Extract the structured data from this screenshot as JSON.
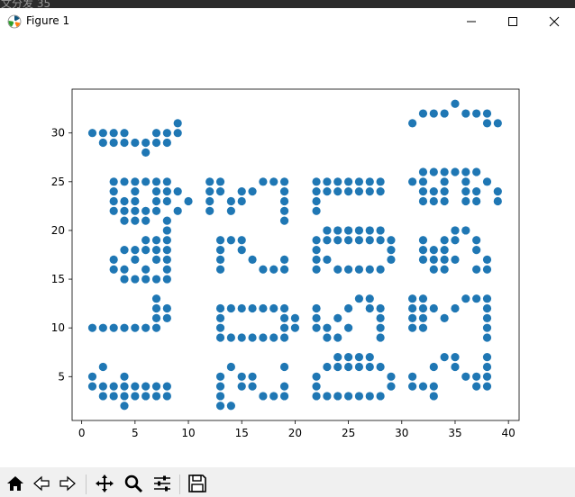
{
  "taskbar": {
    "text": "文分发 35"
  },
  "window": {
    "title": "Figure 1"
  },
  "toolbar": {
    "buttons": [
      "home-icon",
      "back-icon",
      "forward-icon",
      "pan-icon",
      "zoom-icon",
      "configure-subplots-icon",
      "save-icon"
    ]
  },
  "chart_data": {
    "type": "scatter",
    "title": "",
    "xlabel": "",
    "ylabel": "",
    "xlim": [
      -0.9,
      41.0
    ],
    "ylim": [
      0.5,
      34.5
    ],
    "xticks": [
      0,
      5,
      10,
      15,
      20,
      25,
      30,
      35,
      40
    ],
    "yticks": [
      5,
      10,
      15,
      20,
      25,
      30
    ],
    "xtick_labels": [
      "0",
      "5",
      "10",
      "15",
      "20",
      "25",
      "30",
      "35",
      "40"
    ],
    "ytick_labels": [
      "5",
      "10",
      "15",
      "20",
      "25",
      "30"
    ],
    "grid": false,
    "marker_color": "#1f77b4",
    "points": [
      [
        1,
        30
      ],
      [
        2,
        30
      ],
      [
        3,
        30
      ],
      [
        4,
        30
      ],
      [
        2,
        29
      ],
      [
        3,
        29
      ],
      [
        4,
        29
      ],
      [
        5,
        29
      ],
      [
        6,
        29
      ],
      [
        7,
        29
      ],
      [
        8,
        29
      ],
      [
        6,
        28
      ],
      [
        7,
        30
      ],
      [
        8,
        30
      ],
      [
        9,
        30
      ],
      [
        9,
        31
      ],
      [
        3,
        25
      ],
      [
        4,
        25
      ],
      [
        5,
        25
      ],
      [
        6,
        25
      ],
      [
        7,
        25
      ],
      [
        8,
        25
      ],
      [
        3,
        24
      ],
      [
        5,
        24
      ],
      [
        7,
        24
      ],
      [
        8,
        24
      ],
      [
        9,
        24
      ],
      [
        3,
        23
      ],
      [
        4,
        23
      ],
      [
        5,
        23
      ],
      [
        7,
        23
      ],
      [
        8,
        23
      ],
      [
        10,
        23
      ],
      [
        3,
        22
      ],
      [
        4,
        22
      ],
      [
        5,
        22
      ],
      [
        6,
        22
      ],
      [
        7,
        22
      ],
      [
        9,
        22
      ],
      [
        4,
        21
      ],
      [
        5,
        21
      ],
      [
        6,
        21
      ],
      [
        8,
        21
      ],
      [
        8,
        20
      ],
      [
        6,
        19
      ],
      [
        7,
        19
      ],
      [
        8,
        19
      ],
      [
        4,
        18
      ],
      [
        5,
        18
      ],
      [
        6,
        18
      ],
      [
        7,
        18
      ],
      [
        8,
        18
      ],
      [
        3,
        17
      ],
      [
        5,
        17
      ],
      [
        7,
        17
      ],
      [
        8,
        17
      ],
      [
        3,
        16
      ],
      [
        4,
        16
      ],
      [
        6,
        16
      ],
      [
        8,
        16
      ],
      [
        4,
        15
      ],
      [
        5,
        15
      ],
      [
        6,
        15
      ],
      [
        7,
        15
      ],
      [
        8,
        15
      ],
      [
        7,
        13
      ],
      [
        7,
        12
      ],
      [
        8,
        12
      ],
      [
        7,
        11
      ],
      [
        8,
        11
      ],
      [
        1,
        10
      ],
      [
        2,
        10
      ],
      [
        3,
        10
      ],
      [
        4,
        10
      ],
      [
        5,
        10
      ],
      [
        6,
        10
      ],
      [
        7,
        10
      ],
      [
        1,
        5
      ],
      [
        4,
        5
      ],
      [
        2,
        6
      ],
      [
        1,
        4
      ],
      [
        2,
        4
      ],
      [
        3,
        4
      ],
      [
        4,
        4
      ],
      [
        5,
        4
      ],
      [
        6,
        4
      ],
      [
        7,
        4
      ],
      [
        8,
        4
      ],
      [
        2,
        3
      ],
      [
        3,
        3
      ],
      [
        4,
        3
      ],
      [
        5,
        3
      ],
      [
        6,
        3
      ],
      [
        7,
        3
      ],
      [
        8,
        3
      ],
      [
        4,
        2
      ],
      [
        12,
        25
      ],
      [
        13,
        25
      ],
      [
        17,
        25
      ],
      [
        18,
        25
      ],
      [
        19,
        25
      ],
      [
        12,
        24
      ],
      [
        13,
        24
      ],
      [
        15,
        24
      ],
      [
        16,
        24
      ],
      [
        19,
        24
      ],
      [
        12,
        23
      ],
      [
        14,
        23
      ],
      [
        15,
        23
      ],
      [
        19,
        23
      ],
      [
        12,
        22
      ],
      [
        14,
        22
      ],
      [
        19,
        22
      ],
      [
        19,
        21
      ],
      [
        13,
        19
      ],
      [
        14,
        19
      ],
      [
        15,
        19
      ],
      [
        13,
        18
      ],
      [
        15,
        18
      ],
      [
        13,
        17
      ],
      [
        16,
        17
      ],
      [
        19,
        17
      ],
      [
        13,
        16
      ],
      [
        17,
        16
      ],
      [
        18,
        16
      ],
      [
        19,
        16
      ],
      [
        13,
        12
      ],
      [
        14,
        12
      ],
      [
        15,
        12
      ],
      [
        16,
        12
      ],
      [
        17,
        12
      ],
      [
        18,
        12
      ],
      [
        19,
        12
      ],
      [
        13,
        11
      ],
      [
        19,
        11
      ],
      [
        20,
        11
      ],
      [
        13,
        10
      ],
      [
        19,
        10
      ],
      [
        20,
        10
      ],
      [
        13,
        9
      ],
      [
        14,
        9
      ],
      [
        15,
        9
      ],
      [
        16,
        9
      ],
      [
        17,
        9
      ],
      [
        18,
        9
      ],
      [
        19,
        9
      ],
      [
        13,
        5
      ],
      [
        14,
        6
      ],
      [
        15,
        5
      ],
      [
        16,
        5
      ],
      [
        19,
        6
      ],
      [
        13,
        4
      ],
      [
        15,
        4
      ],
      [
        16,
        4
      ],
      [
        19,
        4
      ],
      [
        13,
        3
      ],
      [
        17,
        3
      ],
      [
        18,
        3
      ],
      [
        19,
        3
      ],
      [
        13,
        2
      ],
      [
        14,
        2
      ],
      [
        22,
        25
      ],
      [
        23,
        25
      ],
      [
        24,
        25
      ],
      [
        25,
        25
      ],
      [
        26,
        25
      ],
      [
        27,
        25
      ],
      [
        28,
        25
      ],
      [
        22,
        24
      ],
      [
        23,
        24
      ],
      [
        24,
        24
      ],
      [
        25,
        24
      ],
      [
        26,
        24
      ],
      [
        27,
        24
      ],
      [
        28,
        24
      ],
      [
        22,
        23
      ],
      [
        22,
        22
      ],
      [
        23,
        20
      ],
      [
        24,
        20
      ],
      [
        25,
        20
      ],
      [
        26,
        20
      ],
      [
        27,
        20
      ],
      [
        28,
        20
      ],
      [
        22,
        19
      ],
      [
        23,
        19
      ],
      [
        24,
        19
      ],
      [
        25,
        19
      ],
      [
        26,
        19
      ],
      [
        27,
        19
      ],
      [
        28,
        19
      ],
      [
        29,
        19
      ],
      [
        22,
        18
      ],
      [
        29,
        18
      ],
      [
        22,
        17
      ],
      [
        23,
        17
      ],
      [
        29,
        17
      ],
      [
        22,
        16
      ],
      [
        24,
        16
      ],
      [
        25,
        16
      ],
      [
        26,
        16
      ],
      [
        27,
        16
      ],
      [
        28,
        16
      ],
      [
        26,
        13
      ],
      [
        27,
        13
      ],
      [
        25,
        12
      ],
      [
        27,
        12
      ],
      [
        28,
        12
      ],
      [
        22,
        12
      ],
      [
        22,
        11
      ],
      [
        24,
        11
      ],
      [
        28,
        11
      ],
      [
        22,
        10
      ],
      [
        23,
        10
      ],
      [
        25,
        10
      ],
      [
        28,
        10
      ],
      [
        23,
        9
      ],
      [
        24,
        9
      ],
      [
        28,
        9
      ],
      [
        24,
        7
      ],
      [
        25,
        7
      ],
      [
        26,
        7
      ],
      [
        27,
        7
      ],
      [
        23,
        6
      ],
      [
        24,
        6
      ],
      [
        25,
        6
      ],
      [
        26,
        6
      ],
      [
        27,
        6
      ],
      [
        28,
        6
      ],
      [
        22,
        5
      ],
      [
        29,
        5
      ],
      [
        22,
        4
      ],
      [
        29,
        4
      ],
      [
        22,
        3
      ],
      [
        23,
        3
      ],
      [
        24,
        3
      ],
      [
        25,
        3
      ],
      [
        26,
        3
      ],
      [
        27,
        3
      ],
      [
        28,
        3
      ],
      [
        31,
        31
      ],
      [
        32,
        32
      ],
      [
        33,
        32
      ],
      [
        34,
        32
      ],
      [
        35,
        33
      ],
      [
        36,
        32
      ],
      [
        37,
        32
      ],
      [
        38,
        32
      ],
      [
        38,
        31
      ],
      [
        39,
        31
      ],
      [
        31,
        25
      ],
      [
        32,
        26
      ],
      [
        33,
        26
      ],
      [
        34,
        26
      ],
      [
        35,
        26
      ],
      [
        36,
        26
      ],
      [
        37,
        26
      ],
      [
        32,
        25
      ],
      [
        34,
        25
      ],
      [
        36,
        25
      ],
      [
        38,
        25
      ],
      [
        32,
        24
      ],
      [
        33,
        24
      ],
      [
        34,
        24
      ],
      [
        36,
        24
      ],
      [
        37,
        24
      ],
      [
        39,
        24
      ],
      [
        32,
        23
      ],
      [
        33,
        23
      ],
      [
        34,
        23
      ],
      [
        36,
        23
      ],
      [
        37,
        23
      ],
      [
        39,
        23
      ],
      [
        35,
        20
      ],
      [
        36,
        20
      ],
      [
        32,
        19
      ],
      [
        34,
        19
      ],
      [
        35,
        19
      ],
      [
        37,
        19
      ],
      [
        32,
        18
      ],
      [
        33,
        18
      ],
      [
        34,
        18
      ],
      [
        37,
        18
      ],
      [
        32,
        17
      ],
      [
        33,
        17
      ],
      [
        34,
        17
      ],
      [
        35,
        17
      ],
      [
        38,
        17
      ],
      [
        33,
        16
      ],
      [
        34,
        16
      ],
      [
        37,
        16
      ],
      [
        38,
        16
      ],
      [
        31,
        13
      ],
      [
        32,
        13
      ],
      [
        36,
        13
      ],
      [
        37,
        13
      ],
      [
        38,
        13
      ],
      [
        31,
        12
      ],
      [
        32,
        12
      ],
      [
        33,
        12
      ],
      [
        35,
        12
      ],
      [
        38,
        12
      ],
      [
        31,
        11
      ],
      [
        32,
        11
      ],
      [
        34,
        11
      ],
      [
        38,
        11
      ],
      [
        31,
        10
      ],
      [
        32,
        10
      ],
      [
        38,
        10
      ],
      [
        38,
        9
      ],
      [
        34,
        7
      ],
      [
        35,
        7
      ],
      [
        33,
        6
      ],
      [
        35,
        6
      ],
      [
        38,
        7
      ],
      [
        38,
        6
      ],
      [
        31,
        5
      ],
      [
        36,
        5
      ],
      [
        37,
        5
      ],
      [
        38,
        5
      ],
      [
        31,
        4
      ],
      [
        32,
        4
      ],
      [
        33,
        4
      ],
      [
        37,
        4
      ],
      [
        38,
        4
      ],
      [
        33,
        3
      ]
    ]
  }
}
